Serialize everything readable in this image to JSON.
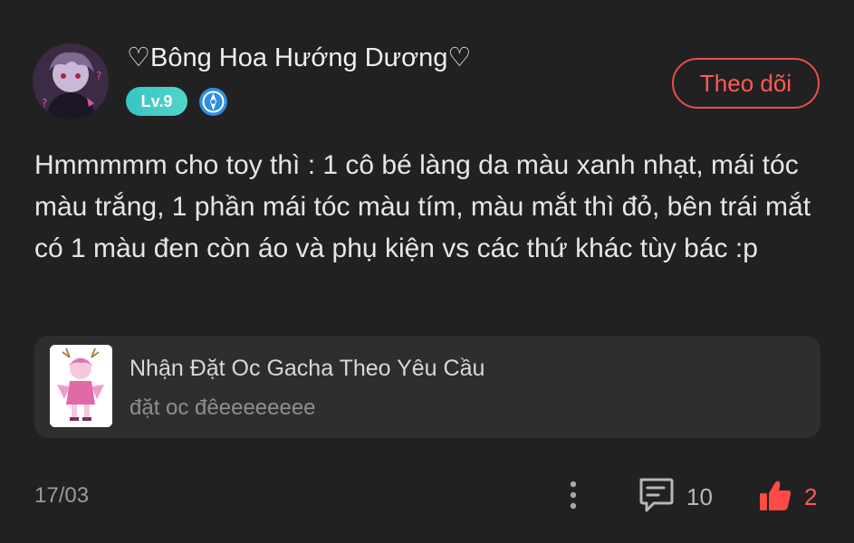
{
  "post": {
    "author": {
      "name": "♡Bông Hoa Hướng Dương♡",
      "level": "Lv.9",
      "avatar_icon": "anime-avatar"
    },
    "follow_label": "Theo dõi",
    "content": "Hmmmmm cho toy thì : 1 cô bé làng da màu xanh nhạt, mái tóc màu trắng, 1 phần mái tóc màu tím, màu mắt thì đỏ, bên trái mắt có 1 màu đen còn áo và phụ kiện vs các thứ khác tùy bác :p",
    "linked_post": {
      "title": "Nhận Đặt Oc Gacha Theo Yêu Cầu",
      "subtitle": "đặt oc đêeeeeeeee"
    },
    "date": "17/03",
    "comment_count": "10",
    "like_count": "2"
  },
  "colors": {
    "background": "#212121",
    "accent": "#ff5a55",
    "level_badge": "#39c3c6",
    "card_background": "#2e2e2e"
  }
}
